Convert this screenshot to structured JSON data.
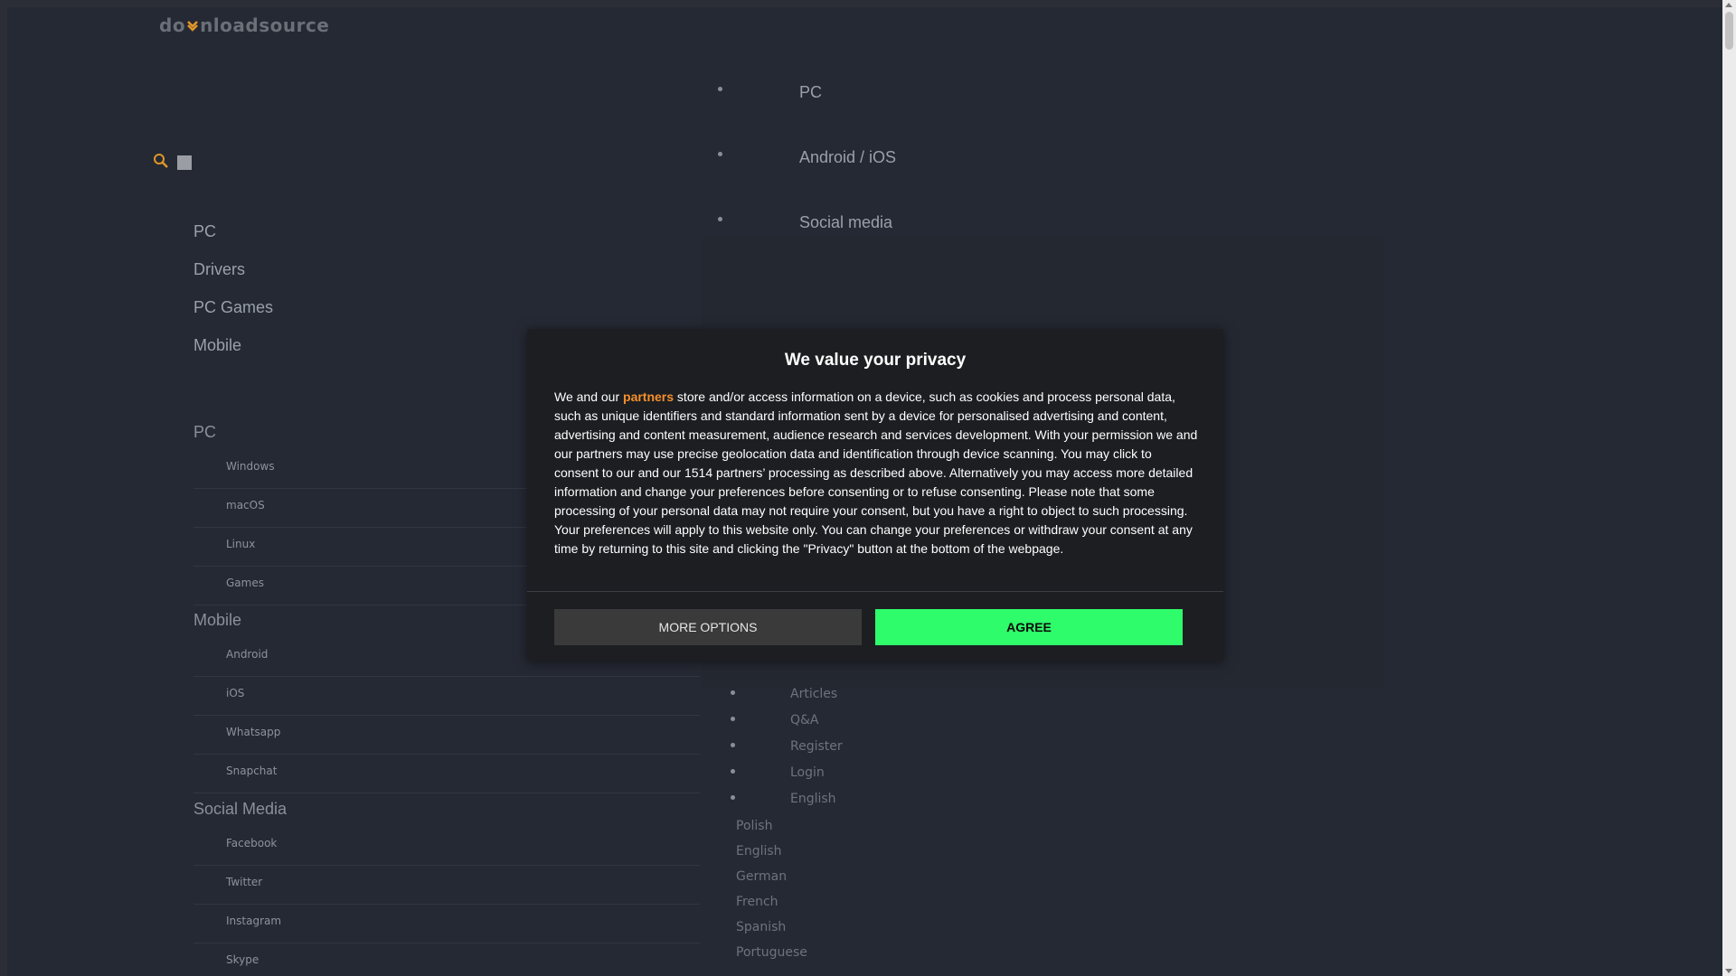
{
  "site": {
    "logo_text": "downloadsource"
  },
  "search": {
    "icon": "search-icon"
  },
  "left_nav_top": [
    "PC",
    "Drivers",
    "PC Games",
    "Mobile"
  ],
  "categories": [
    {
      "title": "PC",
      "items": [
        "Windows",
        "macOS",
        "Linux",
        "Games"
      ]
    },
    {
      "title": "Mobile",
      "items": [
        "Android",
        "iOS",
        "Whatsapp",
        "Snapchat"
      ]
    },
    {
      "title": "Social Media",
      "items": [
        "Facebook",
        "Twitter",
        "Instagram",
        "Skype"
      ]
    }
  ],
  "top_menu": [
    "PC",
    "Android / iOS",
    "Social media"
  ],
  "user_menu": [
    "Articles",
    "Q&A",
    "Register",
    "Login",
    "English"
  ],
  "languages": [
    "Polish",
    "English",
    "German",
    "French",
    "Spanish",
    "Portuguese"
  ],
  "consent": {
    "title": "We value your privacy",
    "text_before_link": "We and our ",
    "link_text": "partners",
    "text_after_link": " store and/or access information on a device, such as cookies and process personal data, such as unique identifiers and standard information sent by a device for personalised advertising and content, advertising and content measurement, audience research and services development. With your permission we and our partners may use precise geolocation data and identification through device scanning. You may click to consent to our and our 1514 partners’ processing as described above. Alternatively you may access more detailed information and change your preferences before consenting or to refuse consenting. Please note that some processing of your personal data may not require your consent, but you have a right to object to such processing. Your preferences will apply to this website only. You can change your preferences or withdraw your consent at any time by returning to this site and clicking the \"Privacy\" button at the bottom of the webpage.",
    "more_options_label": "MORE OPTIONS",
    "agree_label": "AGREE",
    "colors": {
      "link": "#f7902a",
      "agree_bg": "#2efc6a",
      "more_bg": "#3a3a3a"
    }
  }
}
